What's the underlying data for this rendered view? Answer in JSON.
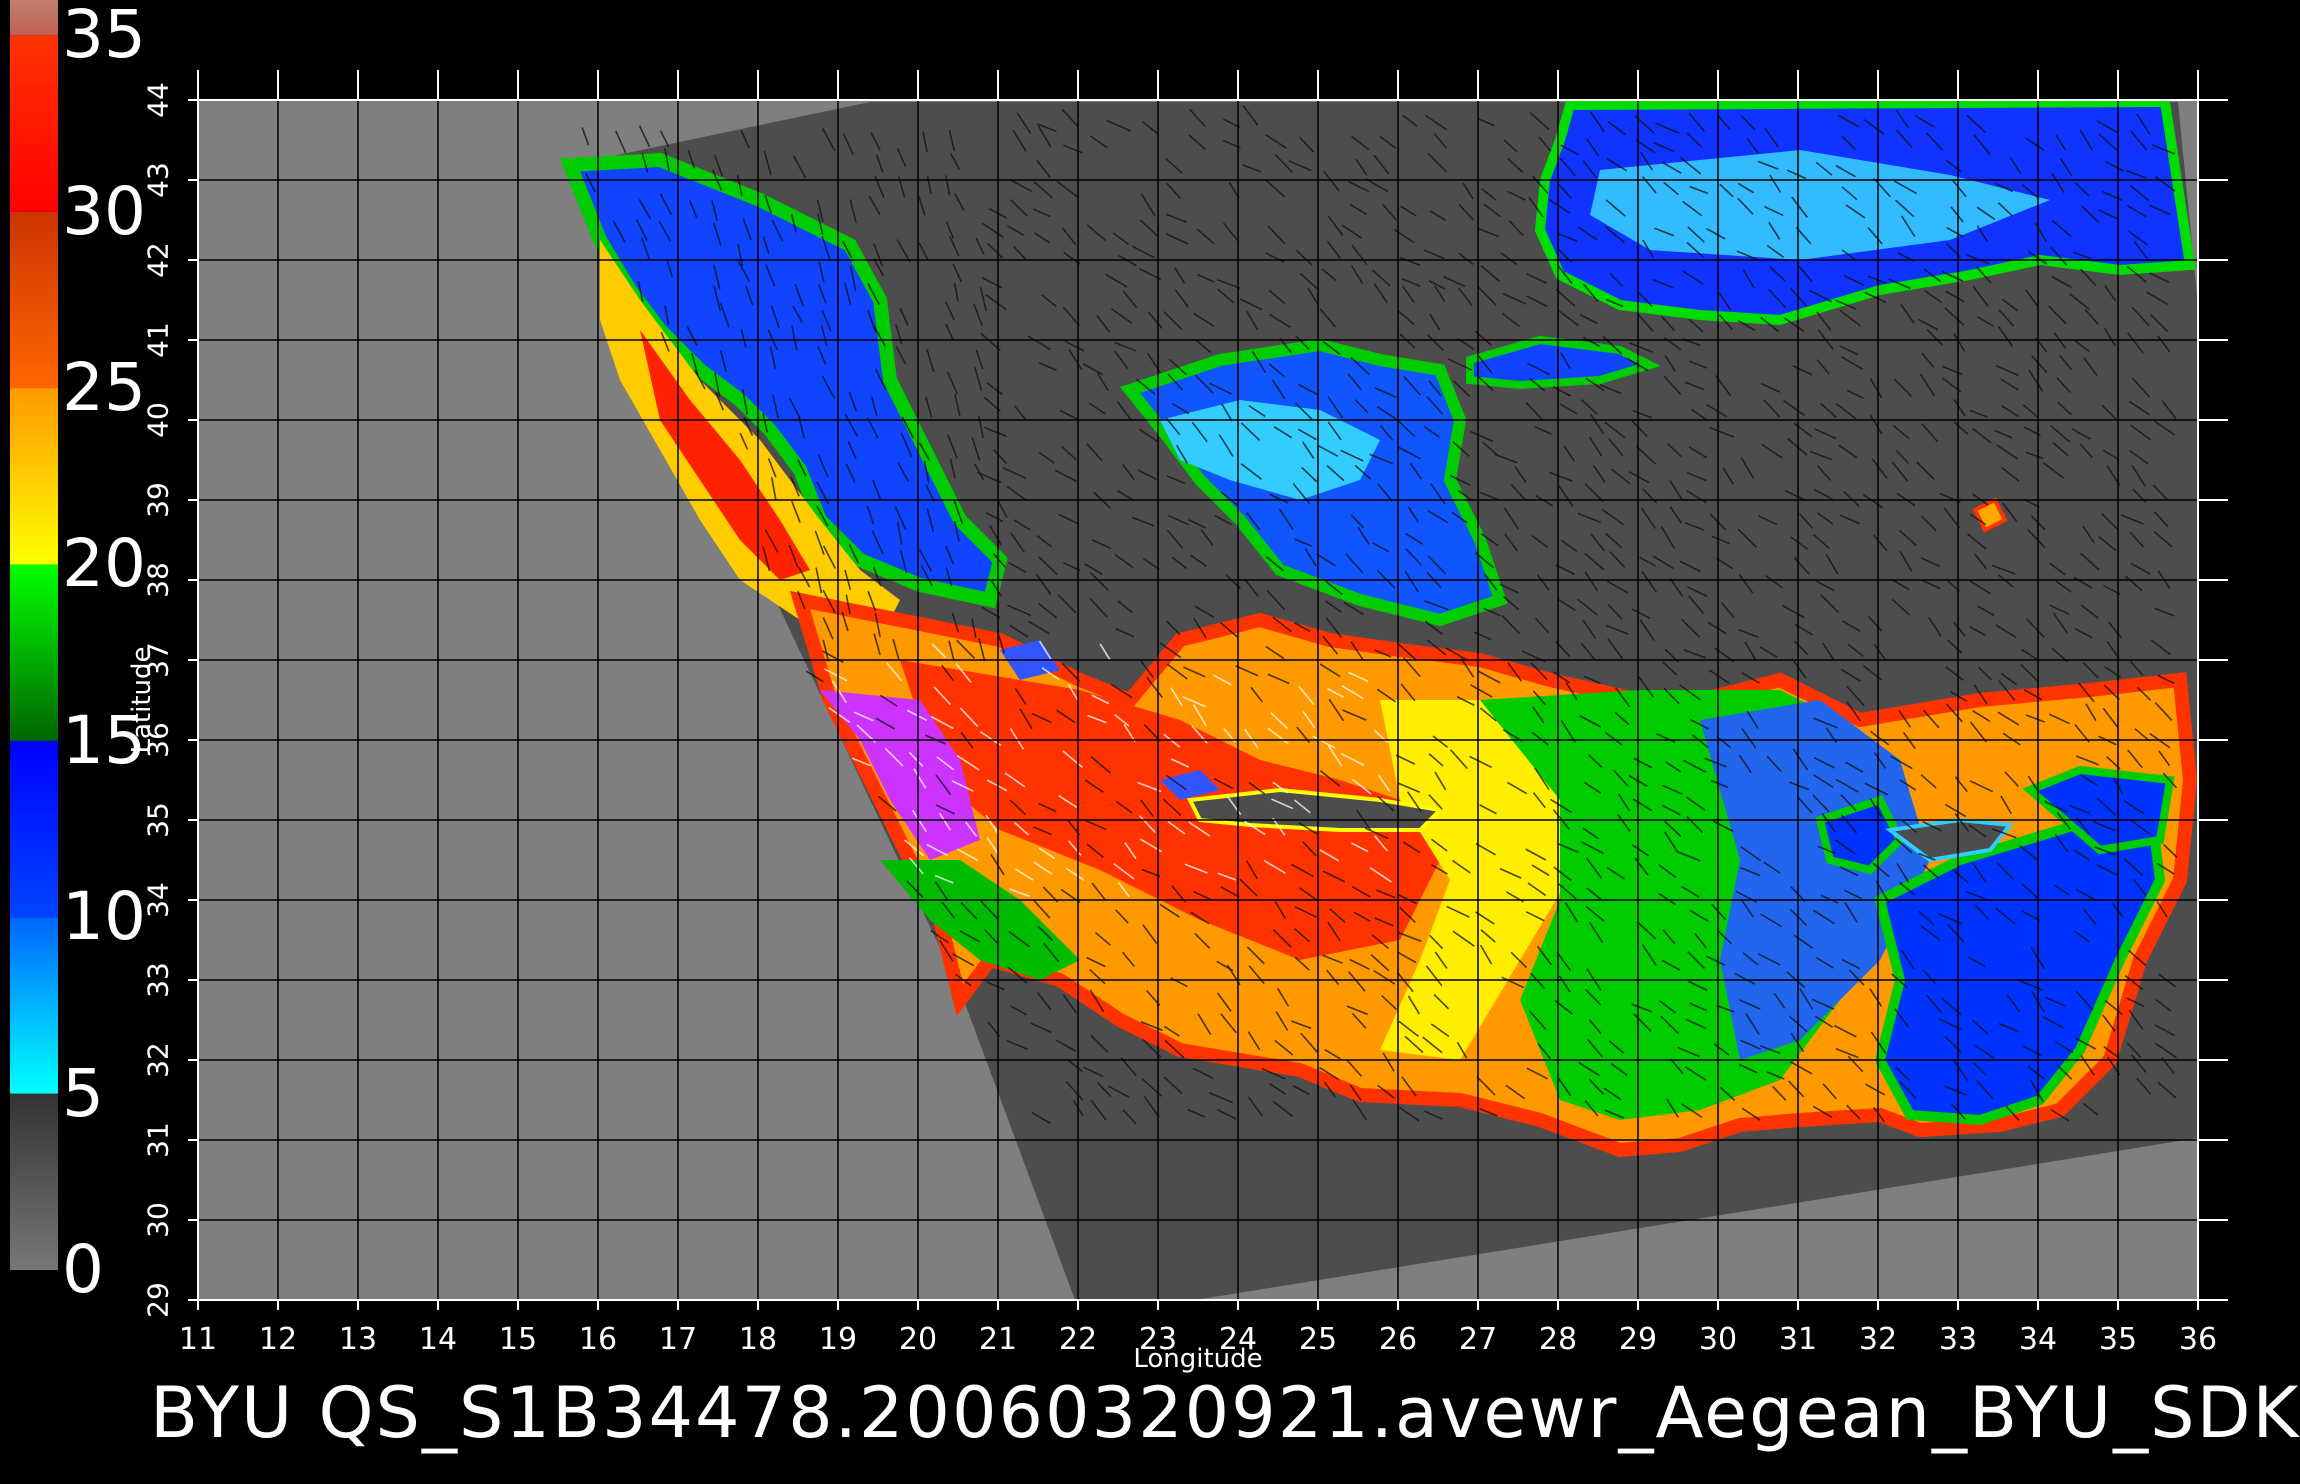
{
  "colorbar": {
    "labels": [
      "35",
      "30",
      "25",
      "20",
      "15",
      "10",
      "5",
      "0"
    ],
    "bands": [
      {
        "from": 0,
        "to": 5,
        "colors": [
          "#777777",
          "#333333"
        ]
      },
      {
        "from": 5,
        "to": 10,
        "colors": [
          "#00ffff",
          "#0066ff"
        ]
      },
      {
        "from": 10,
        "to": 15,
        "colors": [
          "#0044ff",
          "#0000ff"
        ]
      },
      {
        "from": 15,
        "to": 20,
        "colors": [
          "#006600",
          "#00ff00"
        ]
      },
      {
        "from": 20,
        "to": 25,
        "colors": [
          "#ffff00",
          "#ff9900"
        ]
      },
      {
        "from": 25,
        "to": 30,
        "colors": [
          "#ff6600",
          "#cc3300"
        ]
      },
      {
        "from": 30,
        "to": 35,
        "colors": [
          "#ff0000",
          "#ff3300"
        ]
      },
      {
        "from": 35,
        "to": 36,
        "colors": [
          "#c06050",
          "#c08070"
        ]
      }
    ]
  },
  "map": {
    "lon_range": [
      11,
      36
    ],
    "lat_range": [
      29,
      44
    ],
    "x_ticks": [
      "11",
      "12",
      "13",
      "14",
      "15",
      "16",
      "17",
      "18",
      "19",
      "20",
      "21",
      "22",
      "23",
      "24",
      "25",
      "26",
      "27",
      "28",
      "29",
      "30",
      "31",
      "32",
      "33",
      "34",
      "35",
      "36"
    ],
    "y_ticks": [
      "29",
      "30",
      "31",
      "32",
      "33",
      "34",
      "35",
      "36",
      "37",
      "38",
      "39",
      "40",
      "41",
      "42",
      "43",
      "44"
    ],
    "xlabel": "Longitude",
    "ylabel": "Latitude",
    "colors": {
      "background": "#000000",
      "outside_swath": "#7f7f7f",
      "land": "#4d4d4d",
      "grid": "#000000"
    }
  },
  "caption": "BYU QS_S1B34478.20060320921.avewr_Aegean_BYU_SDK"
}
